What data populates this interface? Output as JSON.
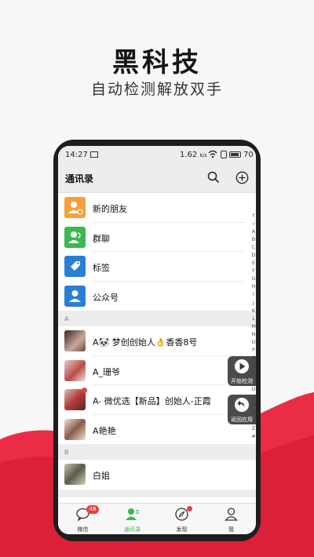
{
  "headline": "黑科技",
  "subline": "自动检测解放双手",
  "colors": {
    "accent_red": "#e8263b",
    "wechat_green": "#3cb84f"
  },
  "status_bar": {
    "time": "14:27",
    "network": "1.62",
    "network_unit": "K/s",
    "battery": "70"
  },
  "title_bar": {
    "title": "通讯录",
    "search_icon": "search-icon",
    "add_icon": "plus-circle-icon"
  },
  "top_items": [
    {
      "label": "新的朋友",
      "icon": "add-friend-icon"
    },
    {
      "label": "群聊",
      "icon": "group-chat-icon"
    },
    {
      "label": "标签",
      "icon": "tag-icon"
    },
    {
      "label": "公众号",
      "icon": "official-account-icon"
    }
  ],
  "sections": [
    {
      "letter": "A",
      "contacts": [
        {
          "name": "A🐼 梦创创始人👌香香8号"
        },
        {
          "name": "A_珊爷"
        },
        {
          "name": "A- 微优选【新品】创始人-正霞"
        },
        {
          "name": "A艳艳"
        }
      ]
    },
    {
      "letter": "B",
      "contacts": [
        {
          "name": "白姐"
        }
      ]
    }
  ],
  "index_letters": [
    "↑",
    "☆",
    "A",
    "B",
    "C",
    "D",
    "E",
    "F",
    "G",
    "H",
    "I",
    "J",
    "K",
    "L",
    "M",
    "N",
    "O",
    "P",
    "Q",
    "R",
    "S",
    "T",
    "U",
    "V",
    "W",
    "X",
    "Y",
    "Z",
    "#"
  ],
  "floating_buttons": {
    "start": "开始检测",
    "back": "返回应用"
  },
  "tabbar": {
    "tabs": [
      {
        "label": "微信",
        "badge": "48"
      },
      {
        "label": "通讯录"
      },
      {
        "label": "发现"
      },
      {
        "label": "我"
      }
    ]
  }
}
